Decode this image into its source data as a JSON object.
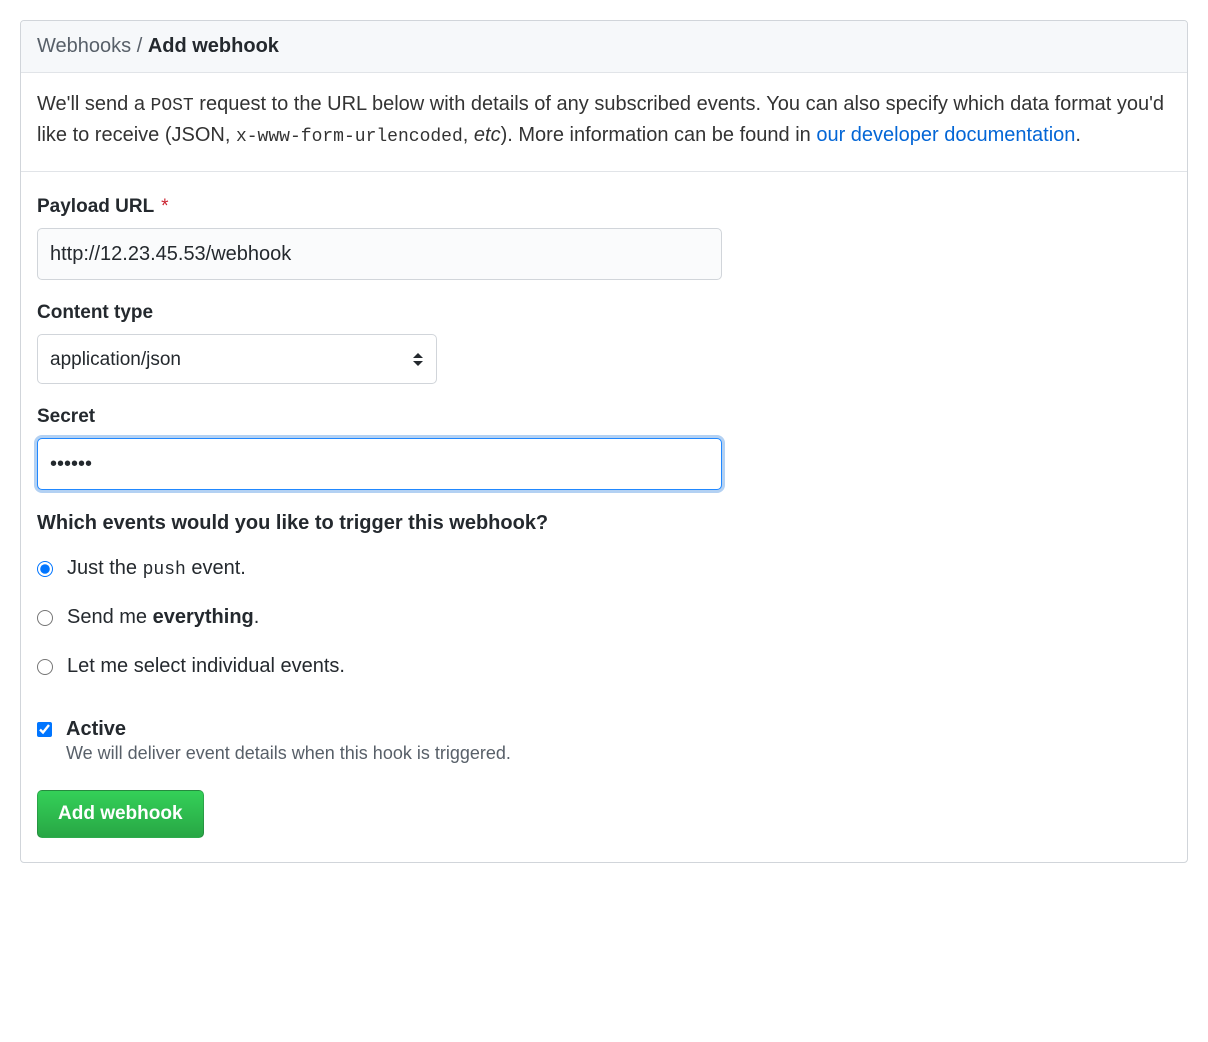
{
  "header": {
    "breadcrumb_parent": "Webhooks",
    "breadcrumb_sep": " / ",
    "breadcrumb_current": "Add webhook"
  },
  "intro": {
    "part1": "We'll send a ",
    "post_code": "POST",
    "part2": " request to the URL below with details of any subscribed events. You can also specify which data format you'd like to receive (JSON, ",
    "code2": "x-www-form-urlencoded",
    "part3": ", ",
    "etc": "etc",
    "part4": "). More information can be found in ",
    "link_text": "our developer documentation",
    "part5": "."
  },
  "form": {
    "payload_url": {
      "label": "Payload URL",
      "required_marker": "*",
      "value": "http://12.23.45.53/webhook"
    },
    "content_type": {
      "label": "Content type",
      "selected": "application/json"
    },
    "secret": {
      "label": "Secret",
      "value": "••••••"
    },
    "events": {
      "heading": "Which events would you like to trigger this webhook?",
      "options": [
        {
          "pre": "Just the ",
          "code": "push",
          "post": " event.",
          "checked": true
        },
        {
          "pre": "Send me ",
          "bold": "everything",
          "post": ".",
          "checked": false
        },
        {
          "pre": "Let me select individual events.",
          "checked": false
        }
      ]
    },
    "active": {
      "label": "Active",
      "description": "We will deliver event details when this hook is triggered.",
      "checked": true
    },
    "submit_label": "Add webhook"
  }
}
